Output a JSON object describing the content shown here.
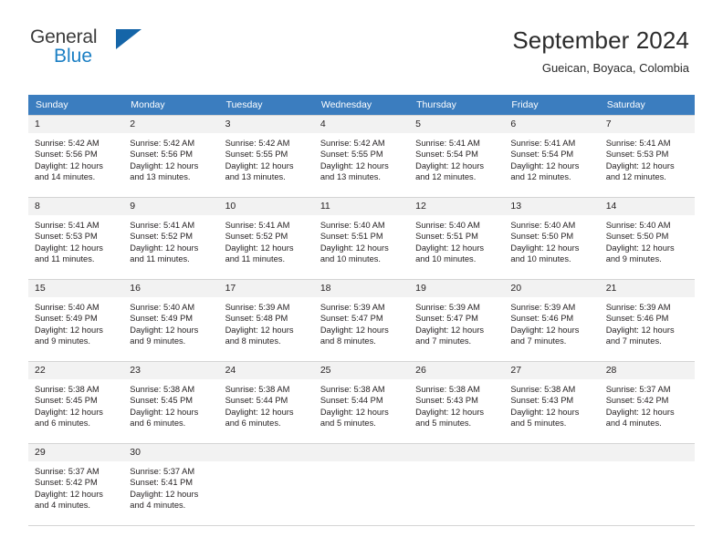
{
  "brand": {
    "word_one": "General",
    "word_two": "Blue",
    "triangle_color": "#1565a8",
    "blue_color": "#1b7fc4"
  },
  "header": {
    "title": "September 2024",
    "subtitle": "Gueican, Boyaca, Colombia",
    "header_bg": "#3b7dbf",
    "daynum_bg": "#f2f2f2"
  },
  "weekday_headers": [
    "Sunday",
    "Monday",
    "Tuesday",
    "Wednesday",
    "Thursday",
    "Friday",
    "Saturday"
  ],
  "weeks": [
    [
      {
        "day": "1",
        "sunrise": "Sunrise: 5:42 AM",
        "sunset": "Sunset: 5:56 PM",
        "daylight1": "Daylight: 12 hours",
        "daylight2": "and 14 minutes."
      },
      {
        "day": "2",
        "sunrise": "Sunrise: 5:42 AM",
        "sunset": "Sunset: 5:56 PM",
        "daylight1": "Daylight: 12 hours",
        "daylight2": "and 13 minutes."
      },
      {
        "day": "3",
        "sunrise": "Sunrise: 5:42 AM",
        "sunset": "Sunset: 5:55 PM",
        "daylight1": "Daylight: 12 hours",
        "daylight2": "and 13 minutes."
      },
      {
        "day": "4",
        "sunrise": "Sunrise: 5:42 AM",
        "sunset": "Sunset: 5:55 PM",
        "daylight1": "Daylight: 12 hours",
        "daylight2": "and 13 minutes."
      },
      {
        "day": "5",
        "sunrise": "Sunrise: 5:41 AM",
        "sunset": "Sunset: 5:54 PM",
        "daylight1": "Daylight: 12 hours",
        "daylight2": "and 12 minutes."
      },
      {
        "day": "6",
        "sunrise": "Sunrise: 5:41 AM",
        "sunset": "Sunset: 5:54 PM",
        "daylight1": "Daylight: 12 hours",
        "daylight2": "and 12 minutes."
      },
      {
        "day": "7",
        "sunrise": "Sunrise: 5:41 AM",
        "sunset": "Sunset: 5:53 PM",
        "daylight1": "Daylight: 12 hours",
        "daylight2": "and 12 minutes."
      }
    ],
    [
      {
        "day": "8",
        "sunrise": "Sunrise: 5:41 AM",
        "sunset": "Sunset: 5:53 PM",
        "daylight1": "Daylight: 12 hours",
        "daylight2": "and 11 minutes."
      },
      {
        "day": "9",
        "sunrise": "Sunrise: 5:41 AM",
        "sunset": "Sunset: 5:52 PM",
        "daylight1": "Daylight: 12 hours",
        "daylight2": "and 11 minutes."
      },
      {
        "day": "10",
        "sunrise": "Sunrise: 5:41 AM",
        "sunset": "Sunset: 5:52 PM",
        "daylight1": "Daylight: 12 hours",
        "daylight2": "and 11 minutes."
      },
      {
        "day": "11",
        "sunrise": "Sunrise: 5:40 AM",
        "sunset": "Sunset: 5:51 PM",
        "daylight1": "Daylight: 12 hours",
        "daylight2": "and 10 minutes."
      },
      {
        "day": "12",
        "sunrise": "Sunrise: 5:40 AM",
        "sunset": "Sunset: 5:51 PM",
        "daylight1": "Daylight: 12 hours",
        "daylight2": "and 10 minutes."
      },
      {
        "day": "13",
        "sunrise": "Sunrise: 5:40 AM",
        "sunset": "Sunset: 5:50 PM",
        "daylight1": "Daylight: 12 hours",
        "daylight2": "and 10 minutes."
      },
      {
        "day": "14",
        "sunrise": "Sunrise: 5:40 AM",
        "sunset": "Sunset: 5:50 PM",
        "daylight1": "Daylight: 12 hours",
        "daylight2": "and 9 minutes."
      }
    ],
    [
      {
        "day": "15",
        "sunrise": "Sunrise: 5:40 AM",
        "sunset": "Sunset: 5:49 PM",
        "daylight1": "Daylight: 12 hours",
        "daylight2": "and 9 minutes."
      },
      {
        "day": "16",
        "sunrise": "Sunrise: 5:40 AM",
        "sunset": "Sunset: 5:49 PM",
        "daylight1": "Daylight: 12 hours",
        "daylight2": "and 9 minutes."
      },
      {
        "day": "17",
        "sunrise": "Sunrise: 5:39 AM",
        "sunset": "Sunset: 5:48 PM",
        "daylight1": "Daylight: 12 hours",
        "daylight2": "and 8 minutes."
      },
      {
        "day": "18",
        "sunrise": "Sunrise: 5:39 AM",
        "sunset": "Sunset: 5:47 PM",
        "daylight1": "Daylight: 12 hours",
        "daylight2": "and 8 minutes."
      },
      {
        "day": "19",
        "sunrise": "Sunrise: 5:39 AM",
        "sunset": "Sunset: 5:47 PM",
        "daylight1": "Daylight: 12 hours",
        "daylight2": "and 7 minutes."
      },
      {
        "day": "20",
        "sunrise": "Sunrise: 5:39 AM",
        "sunset": "Sunset: 5:46 PM",
        "daylight1": "Daylight: 12 hours",
        "daylight2": "and 7 minutes."
      },
      {
        "day": "21",
        "sunrise": "Sunrise: 5:39 AM",
        "sunset": "Sunset: 5:46 PM",
        "daylight1": "Daylight: 12 hours",
        "daylight2": "and 7 minutes."
      }
    ],
    [
      {
        "day": "22",
        "sunrise": "Sunrise: 5:38 AM",
        "sunset": "Sunset: 5:45 PM",
        "daylight1": "Daylight: 12 hours",
        "daylight2": "and 6 minutes."
      },
      {
        "day": "23",
        "sunrise": "Sunrise: 5:38 AM",
        "sunset": "Sunset: 5:45 PM",
        "daylight1": "Daylight: 12 hours",
        "daylight2": "and 6 minutes."
      },
      {
        "day": "24",
        "sunrise": "Sunrise: 5:38 AM",
        "sunset": "Sunset: 5:44 PM",
        "daylight1": "Daylight: 12 hours",
        "daylight2": "and 6 minutes."
      },
      {
        "day": "25",
        "sunrise": "Sunrise: 5:38 AM",
        "sunset": "Sunset: 5:44 PM",
        "daylight1": "Daylight: 12 hours",
        "daylight2": "and 5 minutes."
      },
      {
        "day": "26",
        "sunrise": "Sunrise: 5:38 AM",
        "sunset": "Sunset: 5:43 PM",
        "daylight1": "Daylight: 12 hours",
        "daylight2": "and 5 minutes."
      },
      {
        "day": "27",
        "sunrise": "Sunrise: 5:38 AM",
        "sunset": "Sunset: 5:43 PM",
        "daylight1": "Daylight: 12 hours",
        "daylight2": "and 5 minutes."
      },
      {
        "day": "28",
        "sunrise": "Sunrise: 5:37 AM",
        "sunset": "Sunset: 5:42 PM",
        "daylight1": "Daylight: 12 hours",
        "daylight2": "and 4 minutes."
      }
    ],
    [
      {
        "day": "29",
        "sunrise": "Sunrise: 5:37 AM",
        "sunset": "Sunset: 5:42 PM",
        "daylight1": "Daylight: 12 hours",
        "daylight2": "and 4 minutes."
      },
      {
        "day": "30",
        "sunrise": "Sunrise: 5:37 AM",
        "sunset": "Sunset: 5:41 PM",
        "daylight1": "Daylight: 12 hours",
        "daylight2": "and 4 minutes."
      },
      {
        "day": "",
        "sunrise": "",
        "sunset": "",
        "daylight1": "",
        "daylight2": ""
      },
      {
        "day": "",
        "sunrise": "",
        "sunset": "",
        "daylight1": "",
        "daylight2": ""
      },
      {
        "day": "",
        "sunrise": "",
        "sunset": "",
        "daylight1": "",
        "daylight2": ""
      },
      {
        "day": "",
        "sunrise": "",
        "sunset": "",
        "daylight1": "",
        "daylight2": ""
      },
      {
        "day": "",
        "sunrise": "",
        "sunset": "",
        "daylight1": "",
        "daylight2": ""
      }
    ]
  ]
}
